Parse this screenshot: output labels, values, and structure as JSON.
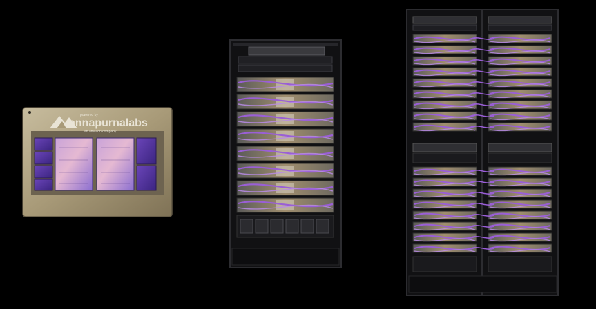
{
  "chip": {
    "powered_by": "powered by",
    "brand": "annapurnalabs",
    "company": "an amazon company"
  },
  "palette": {
    "background": "#000000",
    "chip_frame": "#b5a98a",
    "chip_edge": "#7a6f55",
    "die_purple": "#7b55c4",
    "die_pink": "#d9a9cf",
    "cable_purple": "#9a5fd6",
    "rack_metal": "#151517",
    "tray_tan": "#8f7f62",
    "tray_grey": "#6b6a66"
  }
}
